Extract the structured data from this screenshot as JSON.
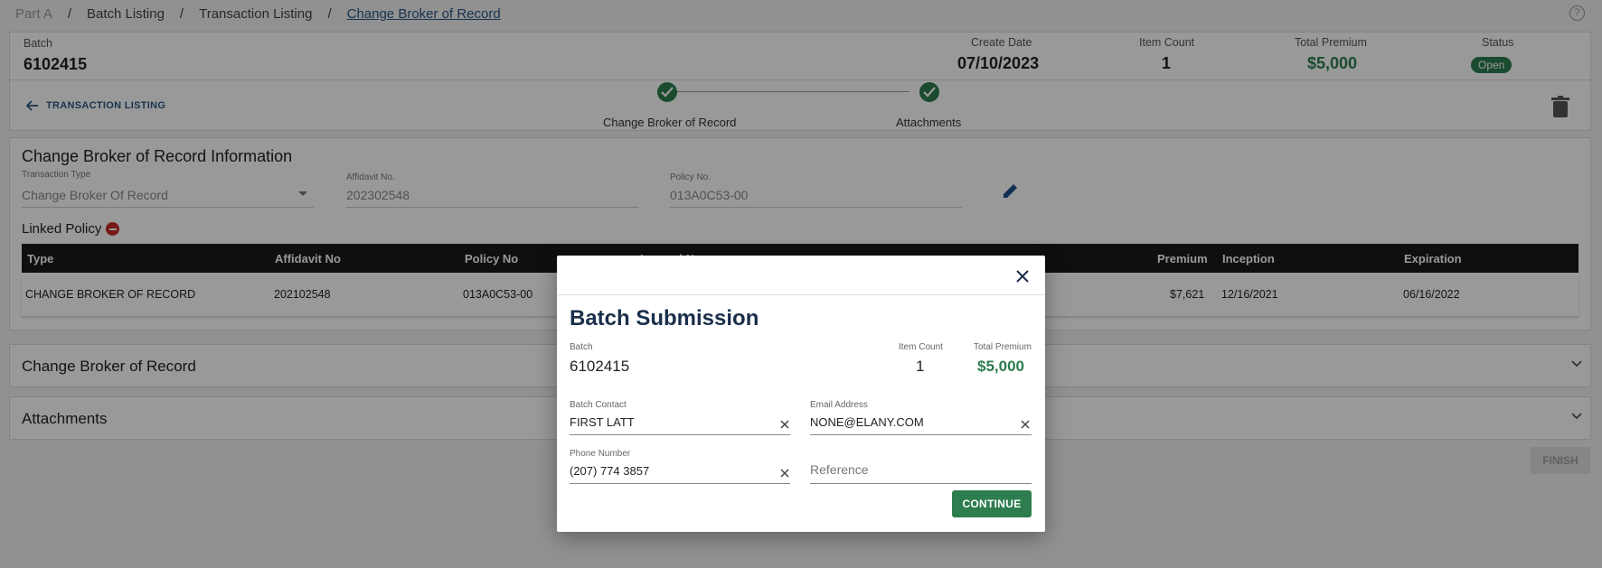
{
  "breadcrumb": {
    "items": [
      "Part A",
      "Batch Listing",
      "Transaction Listing",
      "Change Broker of Record"
    ],
    "separator": "/"
  },
  "header": {
    "batch_label": "Batch",
    "batch_value": "6102415",
    "create_date_label": "Create Date",
    "create_date_value": "07/10/2023",
    "item_count_label": "Item Count",
    "item_count_value": "1",
    "total_premium_label": "Total Premium",
    "total_premium_value": "$5,000",
    "status_label": "Status",
    "status_value": "Open"
  },
  "stepper": {
    "back_label": "TRANSACTION LISTING",
    "steps": [
      "Change Broker of Record",
      "Attachments"
    ]
  },
  "info": {
    "title": "Change Broker of Record Information",
    "transaction_type_label": "Transaction Type",
    "transaction_type_value": "Change Broker Of Record",
    "affidavit_label": "Affidavit No.",
    "affidavit_value": "202302548",
    "policy_label": "Policy No.",
    "policy_value": "013A0C53-00",
    "linked_policy_label": "Linked Policy"
  },
  "table": {
    "headers": [
      "Type",
      "Affidavit No",
      "Policy No",
      "Insured Name",
      "Premium",
      "Inception",
      "Expiration"
    ],
    "rows": [
      [
        "CHANGE BROKER OF RECORD",
        "202102548",
        "013A0C53-00",
        "",
        "$7,621",
        "12/16/2021",
        "06/16/2022"
      ]
    ]
  },
  "accordions": [
    "Change Broker of Record",
    "Attachments"
  ],
  "finish_label": "FINISH",
  "modal": {
    "title": "Batch Submission",
    "batch_label": "Batch",
    "batch_value": "6102415",
    "item_count_label": "Item Count",
    "item_count_value": "1",
    "total_premium_label": "Total Premium",
    "total_premium_value": "$5,000",
    "batch_contact_label": "Batch Contact",
    "batch_contact_value": "FIRST LATT",
    "email_label": "Email Address",
    "email_value": "NONE@ELANY.COM",
    "phone_label": "Phone Number",
    "phone_value": "(207) 774 3857",
    "reference_placeholder": "Reference",
    "continue_label": "CONTINUE"
  },
  "colors": {
    "accent_green": "#2e7d4f",
    "link_blue": "#2a5885",
    "danger_red": "#c62828"
  }
}
